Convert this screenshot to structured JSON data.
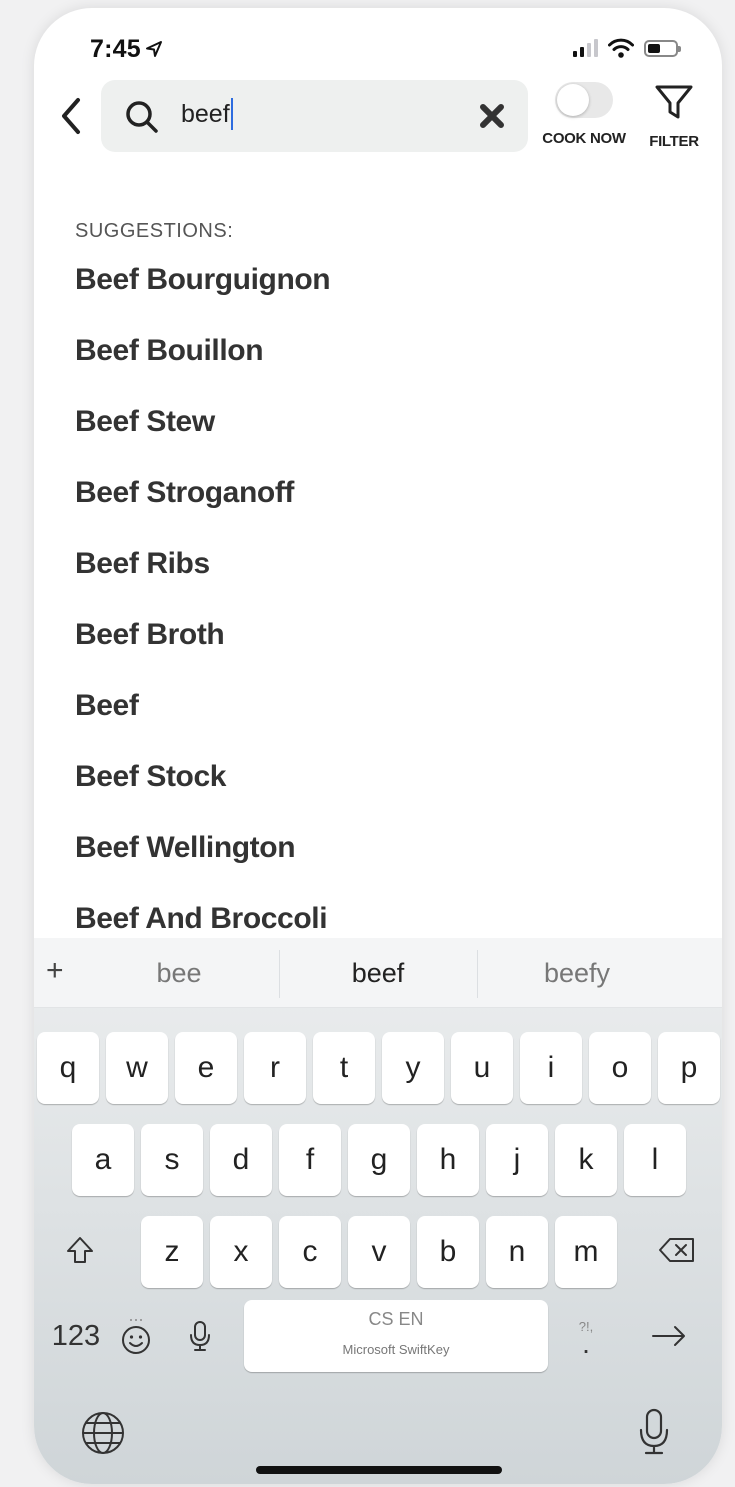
{
  "status": {
    "time": "7:45"
  },
  "search": {
    "query": "beef",
    "cook_now_label": "COOK NOW",
    "filter_label": "FILTER"
  },
  "suggestions": {
    "title": "SUGGESTIONS:",
    "items": [
      "Beef Bourguignon",
      "Beef Bouillon",
      "Beef Stew",
      "Beef Stroganoff",
      "Beef Ribs",
      "Beef Broth",
      "Beef",
      "Beef Stock",
      "Beef Wellington",
      "Beef And Broccoli"
    ]
  },
  "keyboard": {
    "predictions": [
      "bee",
      "beef",
      "beefy"
    ],
    "row1": [
      "q",
      "w",
      "e",
      "r",
      "t",
      "y",
      "u",
      "i",
      "o",
      "p"
    ],
    "row2": [
      "a",
      "s",
      "d",
      "f",
      "g",
      "h",
      "j",
      "k",
      "l"
    ],
    "row3": [
      "z",
      "x",
      "c",
      "v",
      "b",
      "n",
      "m"
    ],
    "numbers_label": "123",
    "space_language": "CS EN",
    "space_brand": "Microsoft SwiftKey",
    "punct_label": "?!,"
  }
}
